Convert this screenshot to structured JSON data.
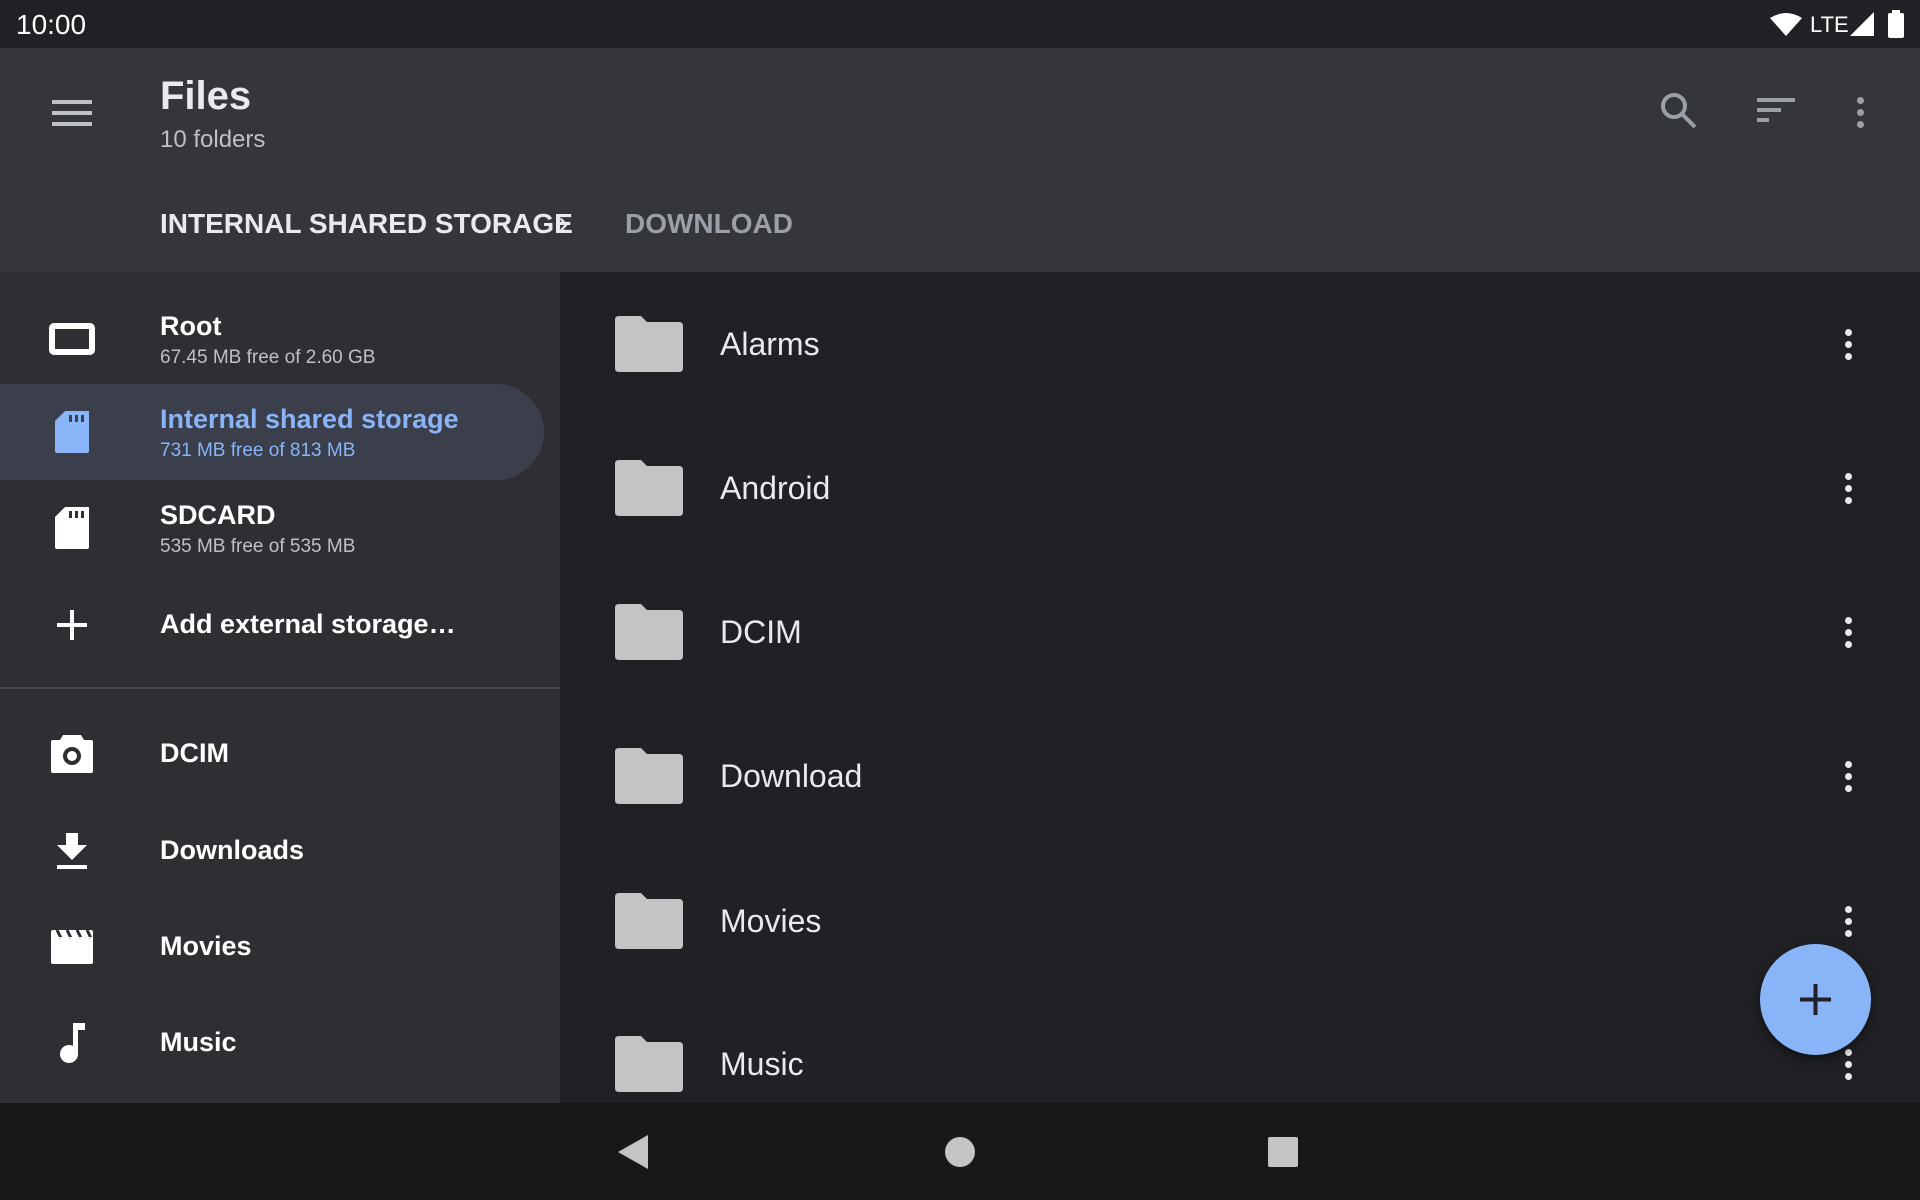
{
  "status_bar": {
    "time": "10:00",
    "network": "LTE"
  },
  "app_bar": {
    "title": "Files",
    "subtitle": "10 folders",
    "actions": [
      "search-icon",
      "sort-icon",
      "more-vert-icon"
    ]
  },
  "breadcrumb": {
    "items": [
      "INTERNAL SHARED STORAGE",
      "DOWNLOAD"
    ]
  },
  "sidebar": {
    "roots": [
      {
        "title": "Root",
        "subtitle": "67.45 MB free of 2.60 GB",
        "icon": "device-icon"
      },
      {
        "title": "Internal shared storage",
        "subtitle": "731 MB free of 813 MB",
        "icon": "sd-card-icon",
        "selected": true
      },
      {
        "title": "SDCARD",
        "subtitle": "535 MB free of 535 MB",
        "icon": "sd-card-icon"
      },
      {
        "title": "Add external storage…",
        "icon": "plus-icon"
      }
    ],
    "shortcuts": [
      {
        "title": "DCIM",
        "icon": "camera-icon"
      },
      {
        "title": "Downloads",
        "icon": "download-icon"
      },
      {
        "title": "Movies",
        "icon": "movie-icon"
      },
      {
        "title": "Music",
        "icon": "music-note-icon"
      }
    ]
  },
  "folders": [
    "Alarms",
    "Android",
    "DCIM",
    "Download",
    "Movies",
    "Music"
  ],
  "colors": {
    "accent": "#8ab4f8",
    "app_bar": "#35363a",
    "sidebar": "#2e2f33",
    "background": "#202124"
  }
}
